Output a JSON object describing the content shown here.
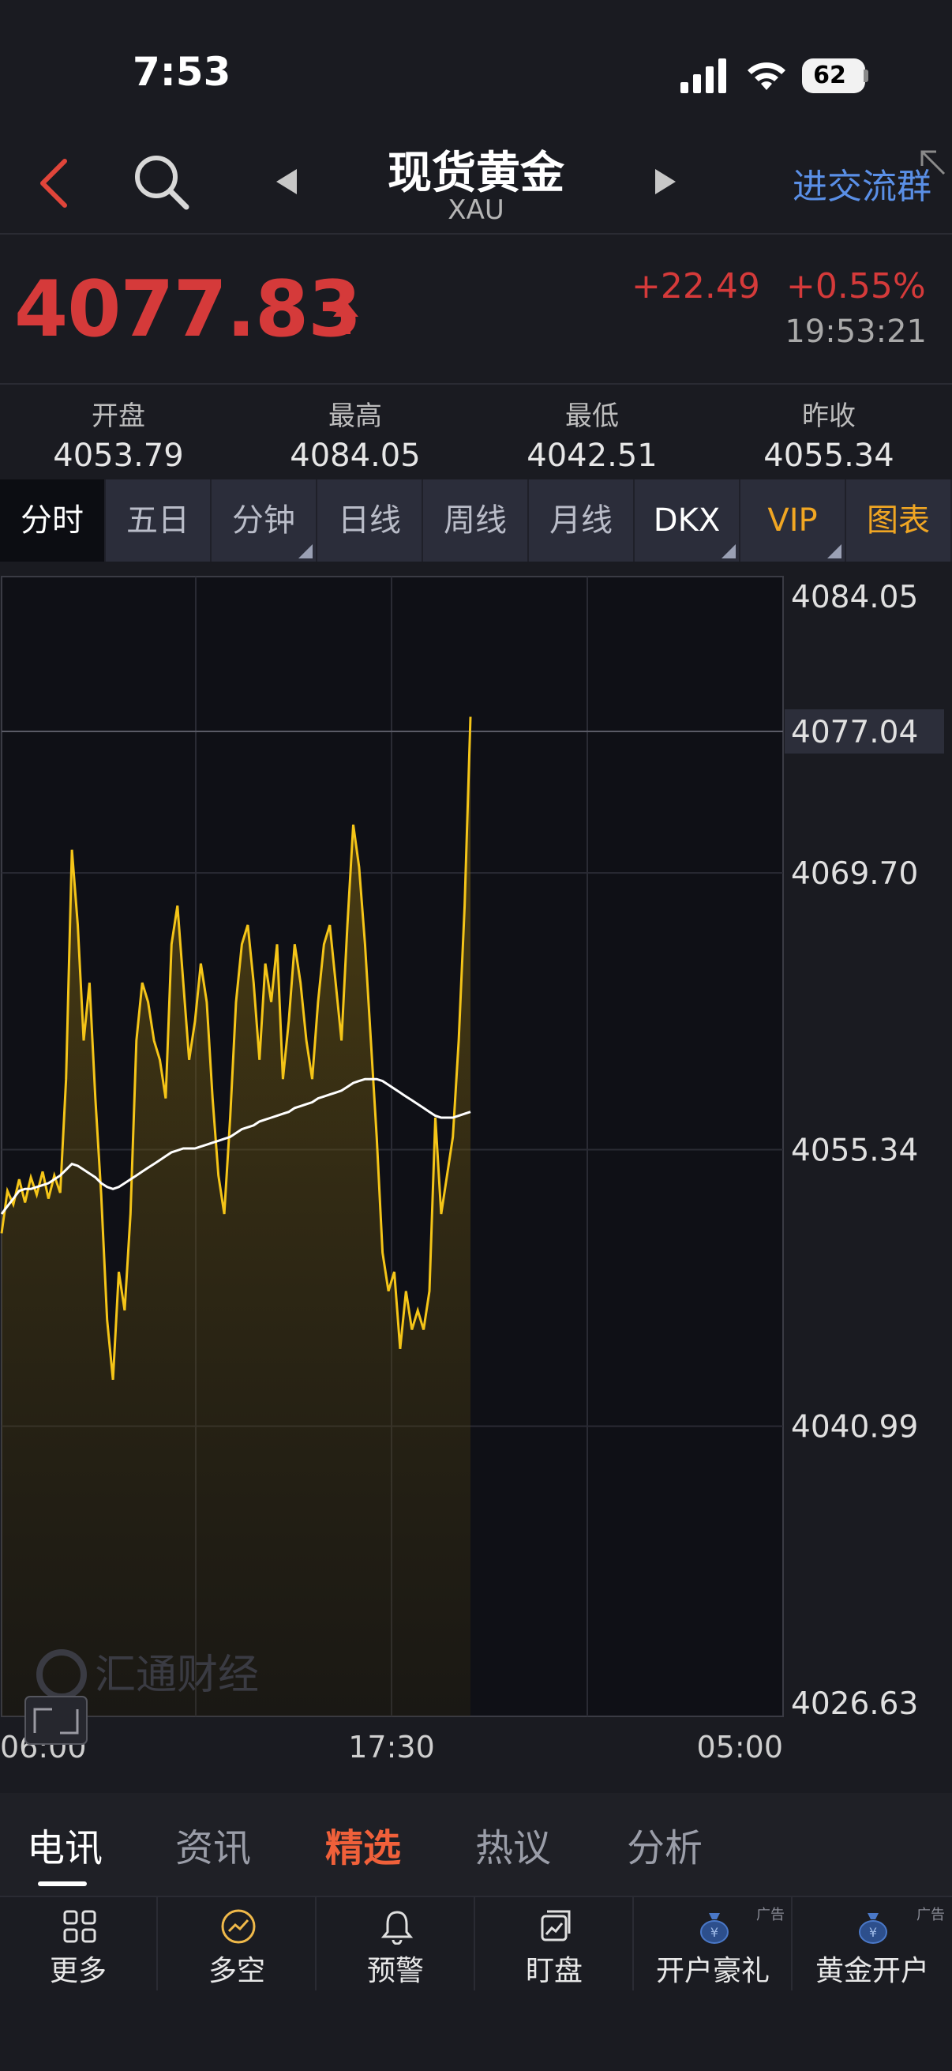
{
  "status_bar": {
    "time": "7:53",
    "battery": "62"
  },
  "nav": {
    "title": "现货黄金",
    "subtitle": "XAU",
    "join_group": "进交流群"
  },
  "quote": {
    "price": "4077.83",
    "change": "+22.49",
    "change_pct": "+0.55%",
    "time": "19:53:21"
  },
  "stats": [
    {
      "label": "开盘",
      "value": "4053.79"
    },
    {
      "label": "最高",
      "value": "4084.05"
    },
    {
      "label": "最低",
      "value": "4042.51"
    },
    {
      "label": "昨收",
      "value": "4055.34"
    }
  ],
  "period_tabs": [
    "分时",
    "五日",
    "分钟",
    "日线",
    "周线",
    "月线",
    "DKX",
    "VIP",
    "图表"
  ],
  "chart_data": {
    "type": "line",
    "y_ticks": [
      "4084.05",
      "4077.04",
      "4069.70",
      "4055.34",
      "4040.99",
      "4026.63"
    ],
    "x_ticks": [
      "06:00",
      "17:30",
      "05:00"
    ],
    "current_price_marker": "4077.04",
    "ylim": [
      4026.63,
      4084.05
    ],
    "series": [
      {
        "color": "#f5c518",
        "values": [
          4051.0,
          4053.2,
          4052.5,
          4053.8,
          4052.6,
          4053.9,
          4053.0,
          4054.2,
          4052.8,
          4054.0,
          4053.1,
          4059.0,
          4070.9,
          4067.0,
          4061.0,
          4064.0,
          4058.0,
          4053.0,
          4046.5,
          4043.4,
          4049.0,
          4047.0,
          4052.0,
          4061.0,
          4064.0,
          4063.0,
          4061.0,
          4060.0,
          4058.0,
          4066.0,
          4068.0,
          4064.0,
          4060.0,
          4062.0,
          4065.0,
          4063.0,
          4058.0,
          4054.0,
          4052.0,
          4057.0,
          4063.0,
          4066.0,
          4067.0,
          4064.0,
          4060.0,
          4065.0,
          4063.0,
          4066.0,
          4059.0,
          4062.0,
          4066.0,
          4064.0,
          4061.0,
          4059.0,
          4063.0,
          4066.0,
          4067.0,
          4064.0,
          4061.0,
          4067.0,
          4072.2,
          4070.0,
          4066.0,
          4061.0,
          4056.0,
          4050.0,
          4048.0,
          4049.0,
          4045.0,
          4048.0,
          4046.0,
          4047.0,
          4046.0,
          4048.0,
          4057.0,
          4052.0,
          4054.0,
          4056.0,
          4061.0,
          4068.0,
          4077.8
        ]
      },
      {
        "color": "#ffffff",
        "values": [
          4052.0,
          4052.4,
          4052.8,
          4053.2,
          4053.3,
          4053.3,
          4053.4,
          4053.5,
          4053.6,
          4053.8,
          4054.0,
          4054.3,
          4054.6,
          4054.5,
          4054.3,
          4054.1,
          4053.9,
          4053.6,
          4053.4,
          4053.3,
          4053.4,
          4053.6,
          4053.8,
          4054.0,
          4054.2,
          4054.4,
          4054.6,
          4054.8,
          4055.0,
          4055.2,
          4055.3,
          4055.4,
          4055.4,
          4055.4,
          4055.5,
          4055.6,
          4055.7,
          4055.8,
          4055.9,
          4056.0,
          4056.2,
          4056.4,
          4056.5,
          4056.6,
          4056.8,
          4056.9,
          4057.0,
          4057.1,
          4057.2,
          4057.3,
          4057.5,
          4057.6,
          4057.7,
          4057.8,
          4058.0,
          4058.1,
          4058.2,
          4058.3,
          4058.4,
          4058.6,
          4058.8,
          4058.9,
          4059.0,
          4059.0,
          4059.0,
          4058.9,
          4058.7,
          4058.5,
          4058.3,
          4058.1,
          4057.9,
          4057.7,
          4057.5,
          4057.3,
          4057.1,
          4057.0,
          4057.0,
          4057.0,
          4057.1,
          4057.2,
          4057.3
        ]
      }
    ]
  },
  "watermark": "汇通财经",
  "content_tabs": [
    "电讯",
    "资讯",
    "精选",
    "热议",
    "分析"
  ],
  "toolbar": [
    {
      "label": "更多",
      "icon": "grid-icon"
    },
    {
      "label": "多空",
      "icon": "trend-circle-icon"
    },
    {
      "label": "预警",
      "icon": "bell-icon"
    },
    {
      "label": "盯盘",
      "icon": "watch-chart-icon"
    },
    {
      "label": "开户豪礼",
      "icon": "money-bag-icon",
      "ad": "广告"
    },
    {
      "label": "黄金开户",
      "icon": "money-bag-icon",
      "ad": "广告"
    }
  ]
}
